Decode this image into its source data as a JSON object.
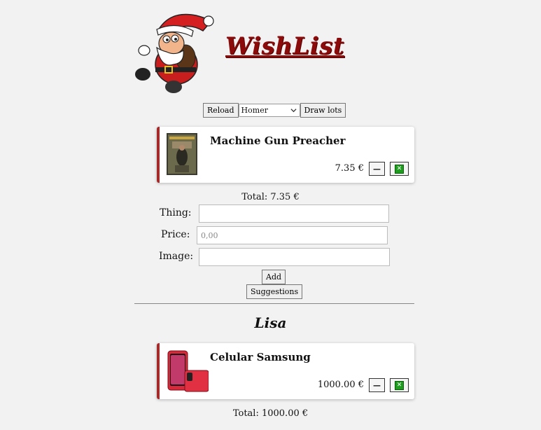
{
  "header": {
    "title": "WishList",
    "logo_icon": "santa-claus-icon"
  },
  "toolbar": {
    "reload_label": "Reload",
    "person_selected": "Homer",
    "draw_lots_label": "Draw lots"
  },
  "lists": [
    {
      "person": "",
      "items": [
        {
          "name": "Machine Gun Preacher",
          "price": "7.35 €",
          "image_icon": "movie-poster-image"
        }
      ],
      "total": "Total: 7.35 €"
    },
    {
      "person": "Lisa",
      "items": [
        {
          "name": "Celular Samsung",
          "price": "1000.00 €",
          "image_icon": "smartphone-image"
        }
      ],
      "total": "Total: 1000.00 €"
    }
  ],
  "form": {
    "thing_label": "Thing:",
    "price_label": "Price:",
    "price_placeholder": "0,00",
    "image_label": "Image:",
    "add_label": "Add",
    "suggestions_label": "Suggestions"
  },
  "colors": {
    "accent": "#8b0a0a",
    "card_border": "#a52a2a",
    "delete_green": "#1f9d1f"
  }
}
